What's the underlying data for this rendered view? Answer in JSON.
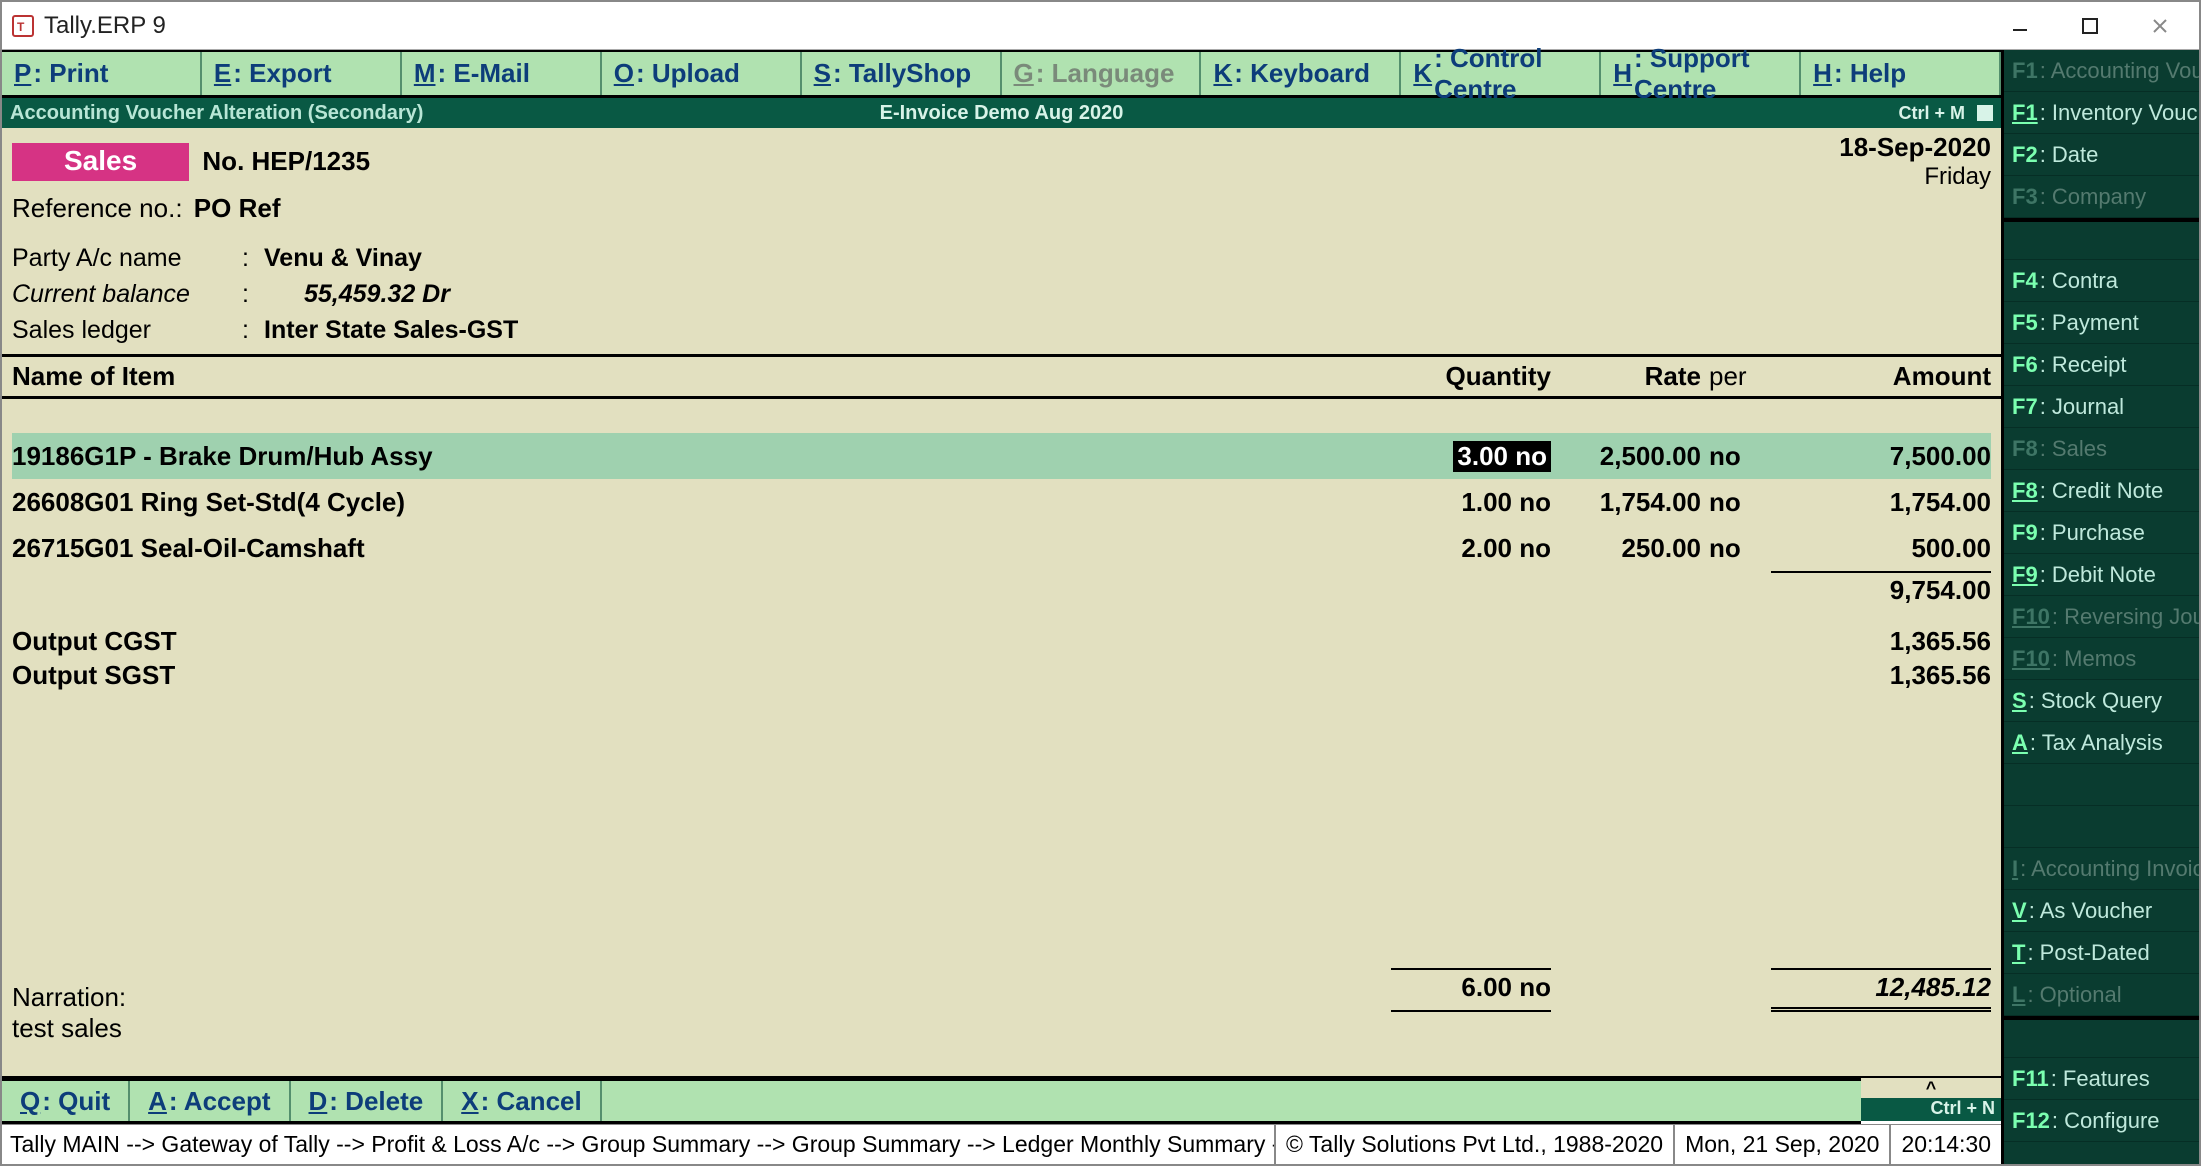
{
  "window": {
    "title": "Tally.ERP 9"
  },
  "menubar": [
    {
      "key": "P",
      "label": ": Print",
      "disabled": false
    },
    {
      "key": "E",
      "label": ": Export",
      "disabled": false
    },
    {
      "key": "M",
      "label": ": E-Mail",
      "disabled": false
    },
    {
      "key": "O",
      "label": ": Upload",
      "disabled": false
    },
    {
      "key": "S",
      "label": ": TallyShop",
      "disabled": false
    },
    {
      "key": "G",
      "label": ": Language",
      "disabled": true
    },
    {
      "key": "K",
      "label": ": Keyboard",
      "disabled": false
    },
    {
      "key": "K",
      "label": ": Control Centre",
      "disabled": false
    },
    {
      "key": "H",
      "label": ": Support Centre",
      "disabled": false
    },
    {
      "key": "H",
      "label": ": Help",
      "disabled": false
    }
  ],
  "subbar": {
    "left": "Accounting Voucher  Alteration  (Secondary)",
    "center": "E-Invoice Demo Aug 2020",
    "right": "Ctrl + M"
  },
  "voucher": {
    "type": "Sales",
    "no_label": "No.",
    "no_value": "HEP/1235",
    "date": "18-Sep-2020",
    "day": "Friday",
    "ref_label": "Reference no.:",
    "ref_value": "PO Ref",
    "party_label": "Party A/c name",
    "party_value": "Venu & Vinay",
    "balance_label": "Current balance",
    "balance_value": "55,459.32 Dr",
    "ledger_label": "Sales ledger",
    "ledger_value": "Inter State Sales-GST"
  },
  "columns": {
    "name": "Name of Item",
    "qty": "Quantity",
    "rate": "Rate",
    "per": "per",
    "amount": "Amount"
  },
  "items": [
    {
      "name": "19186G1P - Brake Drum/Hub Assy",
      "qty_num": "3.00",
      "qty_edit": "3.00",
      "qty_unit": "no",
      "rate": "2,500.00",
      "per": "no",
      "amount": "7,500.00",
      "highlight": true
    },
    {
      "name": "26608G01 Ring Set-Std(4 Cycle)",
      "qty_num": "1.00",
      "qty_unit": "no",
      "rate": "1,754.00",
      "per": "no",
      "amount": "1,754.00",
      "highlight": false
    },
    {
      "name": "26715G01 Seal-Oil-Camshaft",
      "qty_num": "2.00",
      "qty_unit": "no",
      "rate": "250.00",
      "per": "no",
      "amount": "500.00",
      "highlight": false
    }
  ],
  "subtotal": "9,754.00",
  "taxes": [
    {
      "name": "Output CGST",
      "amount": "1,365.56"
    },
    {
      "name": "Output SGST",
      "amount": "1,365.56"
    }
  ],
  "totals": {
    "qty": "6.00 no",
    "amount": "12,485.12"
  },
  "narration": {
    "label": "Narration:",
    "value": "test sales"
  },
  "actions": [
    {
      "key": "Q",
      "label": ": Quit"
    },
    {
      "key": "A",
      "label": ": Accept"
    },
    {
      "key": "D",
      "label": ": Delete"
    },
    {
      "key": "X",
      "label": ": Cancel"
    }
  ],
  "ctrl_n": "Ctrl + N",
  "caret": "^",
  "statusbar": {
    "breadcrumb": "Tally MAIN --> Gateway of Tally --> Profit & Loss A/c --> Group Summary --> Group Summary --> Ledger Monthly Summary --> L",
    "copyright": "© Tally Solutions Pvt Ltd., 1988-2020",
    "date": "Mon, 21 Sep, 2020",
    "time": "20:14:30"
  },
  "fkeys": [
    {
      "fk": "F1",
      "label": ": Accounting Vouchers",
      "disabled": true
    },
    {
      "fk": "F1",
      "label": ": Inventory Vouchers",
      "disabled": false,
      "u": true
    },
    {
      "fk": "F2",
      "label": ": Date",
      "disabled": false
    },
    {
      "fk": "F3",
      "label": ": Company",
      "disabled": true
    },
    {
      "fk": "",
      "label": "",
      "disabled": true,
      "sep": true,
      "blank": true
    },
    {
      "fk": "F4",
      "label": ": Contra",
      "disabled": false
    },
    {
      "fk": "F5",
      "label": ": Payment",
      "disabled": false
    },
    {
      "fk": "F6",
      "label": ": Receipt",
      "disabled": false
    },
    {
      "fk": "F7",
      "label": ": Journal",
      "disabled": false
    },
    {
      "fk": "F8",
      "label": ": Sales",
      "disabled": true
    },
    {
      "fk": "F8",
      "label": ": Credit Note",
      "disabled": false,
      "u": true
    },
    {
      "fk": "F9",
      "label": ": Purchase",
      "disabled": false
    },
    {
      "fk": "F9",
      "label": ": Debit Note",
      "disabled": false,
      "u": true
    },
    {
      "fk": "F10",
      "label": ": Reversing Journal",
      "disabled": true,
      "u": true
    },
    {
      "fk": "F10",
      "label": ": Memos",
      "disabled": true,
      "u": true
    },
    {
      "fk": "S",
      "label": ": Stock Query",
      "disabled": false,
      "u": true
    },
    {
      "fk": "A",
      "label": ": Tax Analysis",
      "disabled": false,
      "u": true
    },
    {
      "fk": "",
      "label": "",
      "disabled": true,
      "blank": true
    },
    {
      "fk": "",
      "label": "",
      "disabled": true,
      "blank": true
    },
    {
      "fk": "I",
      "label": ": Accounting Invoice",
      "disabled": true,
      "u": true
    },
    {
      "fk": "V",
      "label": ": As Voucher",
      "disabled": false,
      "u": true
    },
    {
      "fk": "T",
      "label": ": Post-Dated",
      "disabled": false,
      "u": true
    },
    {
      "fk": "L",
      "label": ": Optional",
      "disabled": true,
      "u": true
    },
    {
      "fk": "",
      "label": "",
      "disabled": true,
      "sep": true,
      "blank": true
    },
    {
      "fk": "F11",
      "label": ": Features",
      "disabled": false
    },
    {
      "fk": "F12",
      "label": ": Configure",
      "disabled": false
    }
  ]
}
